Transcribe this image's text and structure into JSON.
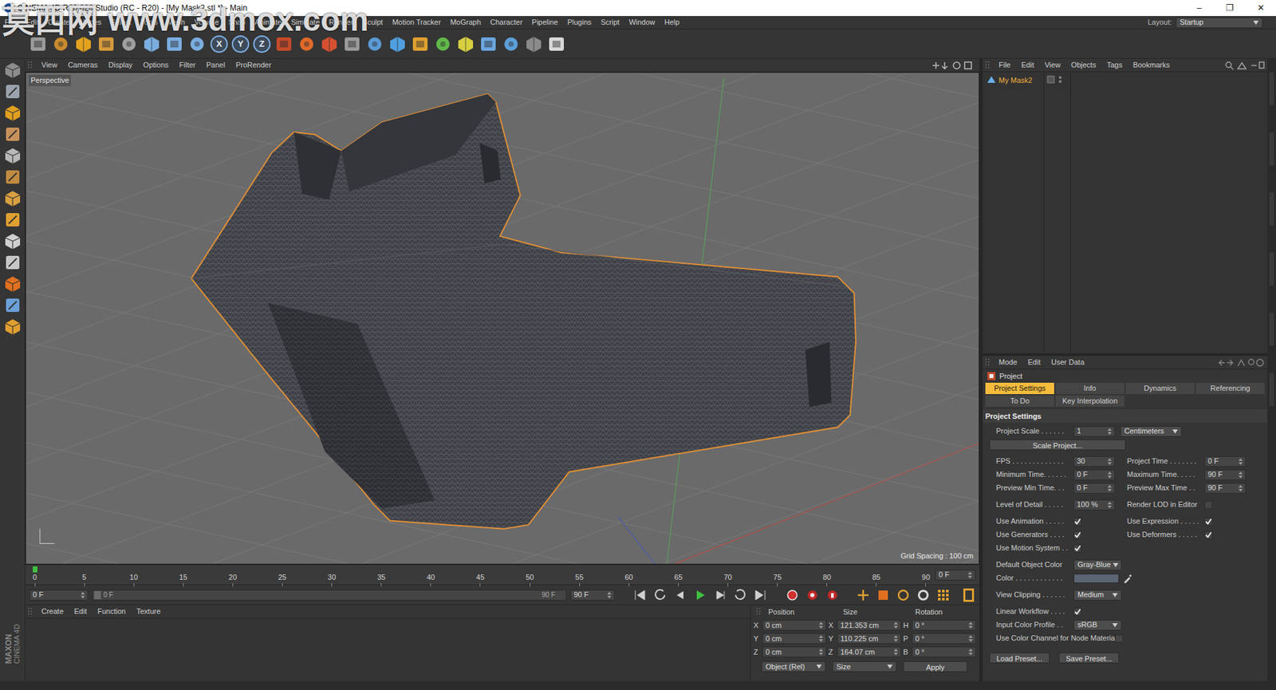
{
  "window": {
    "title": "CINEMA 4D R20.028 Studio (RC - R20) - [My Mask2.stl *] - Main",
    "watermark": "莫西网 www.3dmox.com",
    "controls": [
      "–",
      "❐",
      "✕"
    ]
  },
  "menubar": {
    "items": [
      "File",
      "Edit",
      "Create",
      "Modes",
      "Select",
      "Tools",
      "Mesh",
      "Volume",
      "Snap",
      "Animate",
      "Simulate",
      "Render",
      "Sculpt",
      "Motion Tracker",
      "MoGraph",
      "Character",
      "Pipeline",
      "Plugins",
      "Script",
      "Window",
      "Help"
    ],
    "layout_label": "Layout:",
    "layout_value": "Startup"
  },
  "toolbar": {
    "axis_buttons": [
      "X",
      "Y",
      "Z"
    ]
  },
  "viewport": {
    "menu": [
      "View",
      "Cameras",
      "Display",
      "Options",
      "Filter",
      "Panel",
      "ProRender"
    ],
    "camera": "Perspective",
    "grid_spacing": "Grid Spacing : 100 cm"
  },
  "timeline": {
    "ticks": [
      "0",
      "5",
      "10",
      "15",
      "20",
      "25",
      "30",
      "35",
      "40",
      "45",
      "50",
      "55",
      "60",
      "65",
      "70",
      "75",
      "80",
      "85",
      "90"
    ],
    "frame": "0 F",
    "level": 0
  },
  "transport": {
    "start": "0 F",
    "slider_start": "0 F",
    "slider_end": "90 F",
    "end": "90 F",
    "slider_level": 0
  },
  "material_manager": {
    "menu": [
      "Create",
      "Edit",
      "Function",
      "Texture"
    ]
  },
  "coordinates": {
    "headers": [
      "Position",
      "Size",
      "Rotation"
    ],
    "rows": [
      {
        "axis": "X",
        "position": "0 cm",
        "size_axis": "X",
        "size": "121.353 cm",
        "rot_axis": "H",
        "rotation": "0 °"
      },
      {
        "axis": "Y",
        "position": "0 cm",
        "size_axis": "Y",
        "size": "110.225 cm",
        "rot_axis": "P",
        "rotation": "0 °"
      },
      {
        "axis": "Z",
        "position": "0 cm",
        "size_axis": "Z",
        "size": "164.07 cm",
        "rot_axis": "B",
        "rotation": "0 °"
      }
    ],
    "mode": "Object (Rel)",
    "size_mode": "Size",
    "apply": "Apply"
  },
  "object_manager": {
    "menu": [
      "File",
      "Edit",
      "View",
      "Objects",
      "Tags",
      "Bookmarks"
    ],
    "objects": [
      {
        "name": "My Mask2",
        "selected": true
      }
    ]
  },
  "attributes": {
    "menu": [
      "Mode",
      "Edit",
      "User Data"
    ],
    "object": "Project",
    "tabs": [
      {
        "label": "Project Settings",
        "selected": true
      },
      {
        "label": "Info",
        "selected": false
      },
      {
        "label": "Dynamics",
        "selected": false
      },
      {
        "label": "Referencing",
        "selected": false
      },
      {
        "label": "To Do",
        "selected": false
      },
      {
        "label": "Key Interpolation",
        "selected": false
      }
    ],
    "section": "Project Settings",
    "groups": [
      [
        {
          "kind": "scale",
          "label": "Project Scale . . . . . .",
          "value": "1",
          "unit": "Centimeters"
        },
        {
          "kind": "button",
          "label": "Scale Project..."
        }
      ],
      [
        {
          "kind": "pair",
          "cells": [
            {
              "kind": "number",
              "label": "FPS . . . . . . . . . . . . .",
              "value": "30"
            },
            {
              "kind": "number",
              "label": "Project Time . . . . . . .",
              "value": "0 F"
            }
          ]
        },
        {
          "kind": "pair",
          "cells": [
            {
              "kind": "number",
              "label": "Minimum Time. . . . . .",
              "value": "0 F"
            },
            {
              "kind": "number",
              "label": "Maximum Time. . . . .",
              "value": "90 F"
            }
          ]
        },
        {
          "kind": "pair",
          "cells": [
            {
              "kind": "number",
              "label": "Preview Min Time. . .",
              "value": "0 F"
            },
            {
              "kind": "number",
              "label": "Preview Max Time . .",
              "value": "90 F"
            }
          ]
        }
      ],
      [
        {
          "kind": "pair",
          "cells": [
            {
              "kind": "number",
              "label": "Level of Detail . . . . .",
              "value": "100 %"
            },
            {
              "kind": "checkbox",
              "label": "Render LOD in Editor",
              "checked": false
            }
          ]
        }
      ],
      [
        {
          "kind": "pair",
          "cells": [
            {
              "kind": "checkbox",
              "label": "Use Animation . . . . .",
              "checked": true
            },
            {
              "kind": "checkbox",
              "label": "Use Expression . . . . .",
              "checked": true
            }
          ]
        },
        {
          "kind": "pair",
          "cells": [
            {
              "kind": "checkbox",
              "label": "Use Generators . . . .",
              "checked": true
            },
            {
              "kind": "checkbox",
              "label": "Use Deformers . . . . .",
              "checked": true
            }
          ]
        },
        {
          "kind": "pair",
          "cells": [
            {
              "kind": "checkbox",
              "label": "Use Motion System . .",
              "checked": true
            }
          ]
        }
      ],
      [
        {
          "kind": "pair",
          "cells": [
            {
              "kind": "dropdown",
              "label": "Default Object Color",
              "value": "Gray-Blue"
            }
          ]
        },
        {
          "kind": "pair",
          "cells": [
            {
              "kind": "color",
              "label": "Color . . . . . . . . . . . .",
              "color": "#5b6472"
            }
          ]
        }
      ],
      [
        {
          "kind": "pair",
          "cells": [
            {
              "kind": "dropdown",
              "label": "View Clipping . . . . . .",
              "value": "Medium"
            }
          ]
        }
      ],
      [
        {
          "kind": "pair",
          "cells": [
            {
              "kind": "checkbox",
              "label": "Linear Workflow . . . .",
              "checked": true
            }
          ]
        },
        {
          "kind": "pair",
          "cells": [
            {
              "kind": "dropdown",
              "label": "Input Color Profile . .",
              "value": "sRGB"
            }
          ]
        },
        {
          "kind": "pair",
          "cells": [
            {
              "kind": "checkbox",
              "label": "Use Color Channel for Node Material",
              "checked": false
            }
          ]
        }
      ],
      [
        {
          "kind": "buttons",
          "items": [
            "Load Preset...",
            "Save Preset..."
          ]
        }
      ]
    ]
  },
  "logo": [
    "MAXON",
    "CINEMA 4D"
  ]
}
